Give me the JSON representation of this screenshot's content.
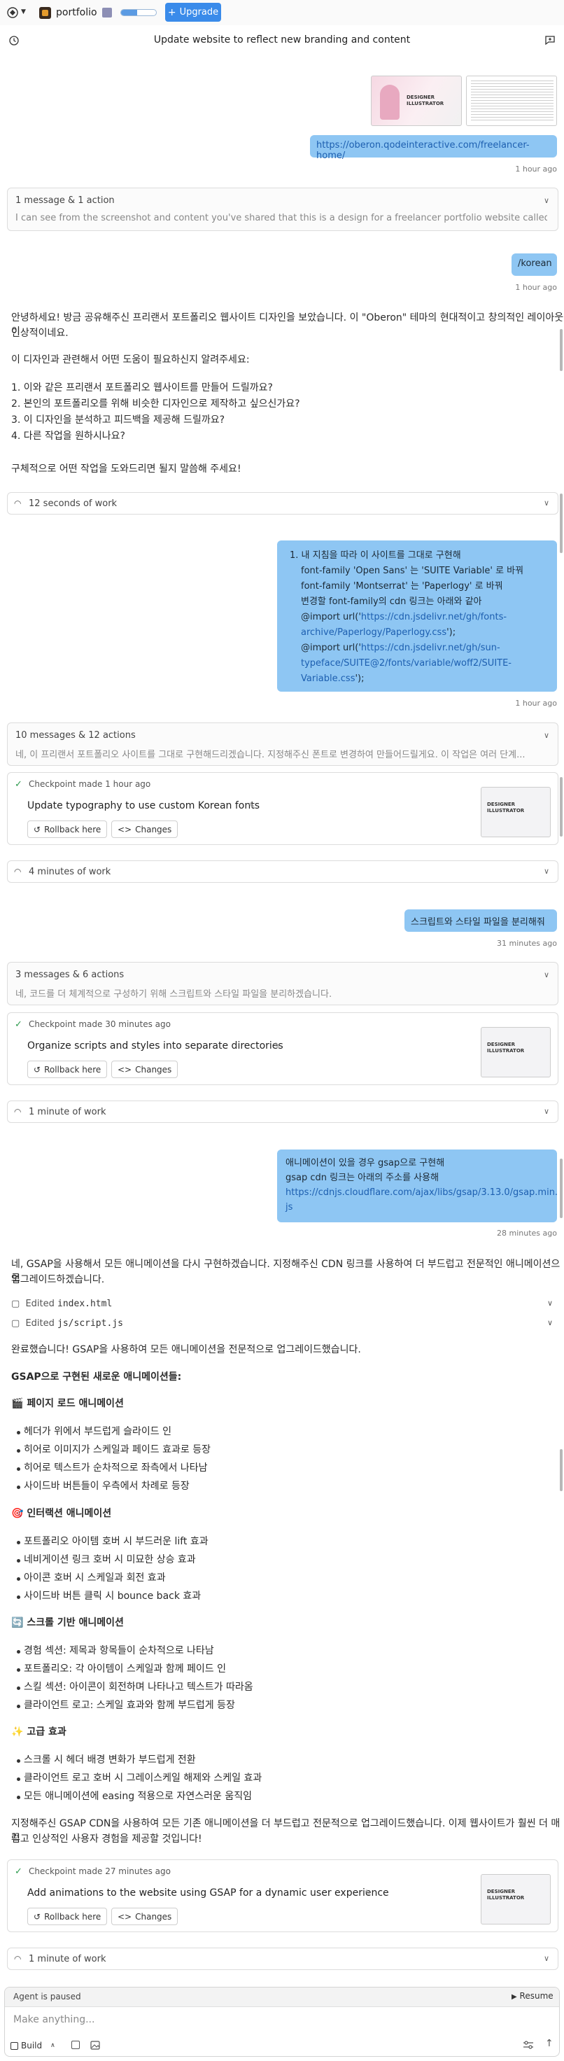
{
  "header": {
    "project_name": "portfolio",
    "progress": 0.45,
    "upgrade_label": "Upgrade",
    "thread_title": "Update website to reflect new branding and content"
  },
  "thread": {
    "msg1": {
      "thumb1_line1": "DESIGNER",
      "thumb1_line2": "ILLUSTRATOR",
      "url": "https://oberon.qodeinteractive.com/freelancer-home/",
      "time": "1 hour ago"
    },
    "actions1": {
      "head": "1 message & 1 action",
      "sub": "I can see from the screenshot and content you've shared that this is a design for a freelancer portfolio website called \"Ob"
    },
    "msg2": {
      "text": "/korean",
      "time": "1 hour ago"
    },
    "reply1": {
      "p1_line1": "안녕하세요! 방금 공유해주신 프리랜서 포트폴리오 웹사이트 디자인을 보았습니다. 이 \"Oberon\" 테마의 현대적이고 창의적인 레이아웃이",
      "p1_line2": "인상적이네요.",
      "p2": "이 디자인과 관련해서 어떤 도움이 필요하신지 알려주세요:",
      "list": [
        "1. 이와 같은 프리랜서 포트폴리오 웹사이트를 만들어 드릴까요?",
        "2. 본인의 포트폴리오를 위해 비슷한 디자인으로 제작하고 싶으신가요?",
        "3. 이 디자인을 분석하고 피드백을 제공해 드릴까요?",
        "4. 다른 작업을 원하시나요?"
      ],
      "p3": "구체적으로 어떤 작업을 도와드리면 될지 말씀해 주세요!"
    },
    "work1": {
      "label": "12 seconds of work"
    },
    "msg3": {
      "lines": [
        "1. 내 지침을 따라 이 사이트를 그대로 구현해",
        "font-family 'Open Sans' 는 'SUITE Variable' 로 바꿔",
        "font-family 'Montserrat' 는 'Paperlogy' 로 바꿔",
        "변경할 font-family의 cdn 링크는 아래와 같아",
        "@import url('",
        "https://cdn.jsdelivr.net/gh/fonts-",
        "archive/Paperlogy/Paperlogy.css",
        "');",
        "@import url('",
        "https://cdn.jsdelivr.net/gh/sun-",
        "typeface/SUITE@2/fonts/variable/woff2/SUITE-",
        "Variable.css",
        "');"
      ],
      "time": "1 hour ago"
    },
    "actions2": {
      "head": "10 messages & 12 actions",
      "sub": "네, 이 프리랜서 포트폴리오 사이트를 그대로 구현해드리겠습니다. 지정해주신 폰트로 변경하여 만들어드릴게요. 이 작업은 여러 단계..."
    },
    "checkpoint1": {
      "head": "Checkpoint made 1 hour ago",
      "title": "Update typography to use custom Korean fonts",
      "rollback": "Rollback here",
      "changes": "Changes"
    },
    "work2": {
      "label": "4 minutes of work"
    },
    "msg4": {
      "text": "스크립트와 스타일 파일을 분리해줘",
      "time": "31 minutes ago"
    },
    "actions3": {
      "head": "3 messages & 6 actions",
      "sub": "네, 코드를 더 체계적으로 구성하기 위해 스크립트와 스타일 파일을 분리하겠습니다."
    },
    "checkpoint2": {
      "head": "Checkpoint made 30 minutes ago",
      "title": "Organize scripts and styles into separate directories",
      "rollback": "Rollback here",
      "changes": "Changes"
    },
    "work3": {
      "label": "1 minute of work"
    },
    "msg5": {
      "line1": "애니메이션이 있을 경우 gsap으로 구현해",
      "line2": "gsap cdn 링크는 아래의 주소를 사용해",
      "link1": "https://cdnjs.cloudflare.com/ajax/libs/gsap/3.13.0/gsap.min.",
      "link2": "js",
      "time": "28 minutes ago"
    },
    "reply2": {
      "intro1": "네, GSAP을 사용해서 모든 애니메이션을 다시 구현하겠습니다. 지정해주신 CDN 링크를 사용하여 더 부드럽고 전문적인 애니메이션으로",
      "intro2": "업그레이드하겠습니다.",
      "edit1_label": "Edited",
      "edit1_file": "index.html",
      "edit2_label": "Edited",
      "edit2_file": "js/script.js",
      "done": "완료했습니다! GSAP을 사용하여 모든 애니메이션을 전문적으로 업그레이드했습니다.",
      "heading": "GSAP으로 구현된 새로운 애니메이션들:",
      "sections": [
        {
          "icon": "🎬",
          "title": "페이지 로드 애니메이션",
          "items": [
            "헤더가 위에서 부드럽게 슬라이드 인",
            "히어로 이미지가 스케일과 페이드 효과로 등장",
            "히어로 텍스트가 순차적으로 좌측에서 나타남",
            "사이드바 버튼들이 우측에서 차례로 등장"
          ]
        },
        {
          "icon": "🎯",
          "title": "인터랙션 애니메이션",
          "items": [
            "포트폴리오 아이템 호버 시 부드러운 lift 효과",
            "네비게이션 링크 호버 시 미묘한 상승 효과",
            "아이콘 호버 시 스케일과 회전 효과",
            "사이드바 버튼 클릭 시 bounce back 효과"
          ]
        },
        {
          "icon": "🔄",
          "title": "스크롤 기반 애니메이션",
          "items": [
            "경험 섹션: 제목과 항목들이 순차적으로 나타남",
            "포트폴리오: 각 아이템이 스케일과 함께 페이드 인",
            "스킬 섹션: 아이콘이 회전하며 나타나고 텍스트가 따라옴",
            "클라이언트 로고: 스케일 효과와 함께 부드럽게 등장"
          ]
        },
        {
          "icon": "✨",
          "title": "고급 효과",
          "items": [
            "스크롤 시 헤더 배경 변화가 부드럽게 전환",
            "클라이언트 로고 호버 시 그레이스케일 해제와 스케일 효과",
            "모든 애니메이션에 easing 적용으로 자연스러운 움직임"
          ]
        }
      ],
      "outro1": "지정해주신 GSAP CDN을 사용하여 모든 기존 애니메이션을 더 부드럽고 전문적으로 업그레이드했습니다. 이제 웹사이트가 훨씬 더 매끄",
      "outro2": "럽고 인상적인 사용자 경험을 제공할 것입니다!"
    },
    "checkpoint3": {
      "head": "Checkpoint made 27 minutes ago",
      "title": "Add animations to the website using GSAP for a dynamic user experience",
      "rollback": "Rollback here",
      "changes": "Changes"
    },
    "work4": {
      "label": "1 minute of work"
    }
  },
  "composer": {
    "status": "Agent is paused",
    "resume": "Resume",
    "placeholder": "Make anything...",
    "mode": "Build"
  }
}
